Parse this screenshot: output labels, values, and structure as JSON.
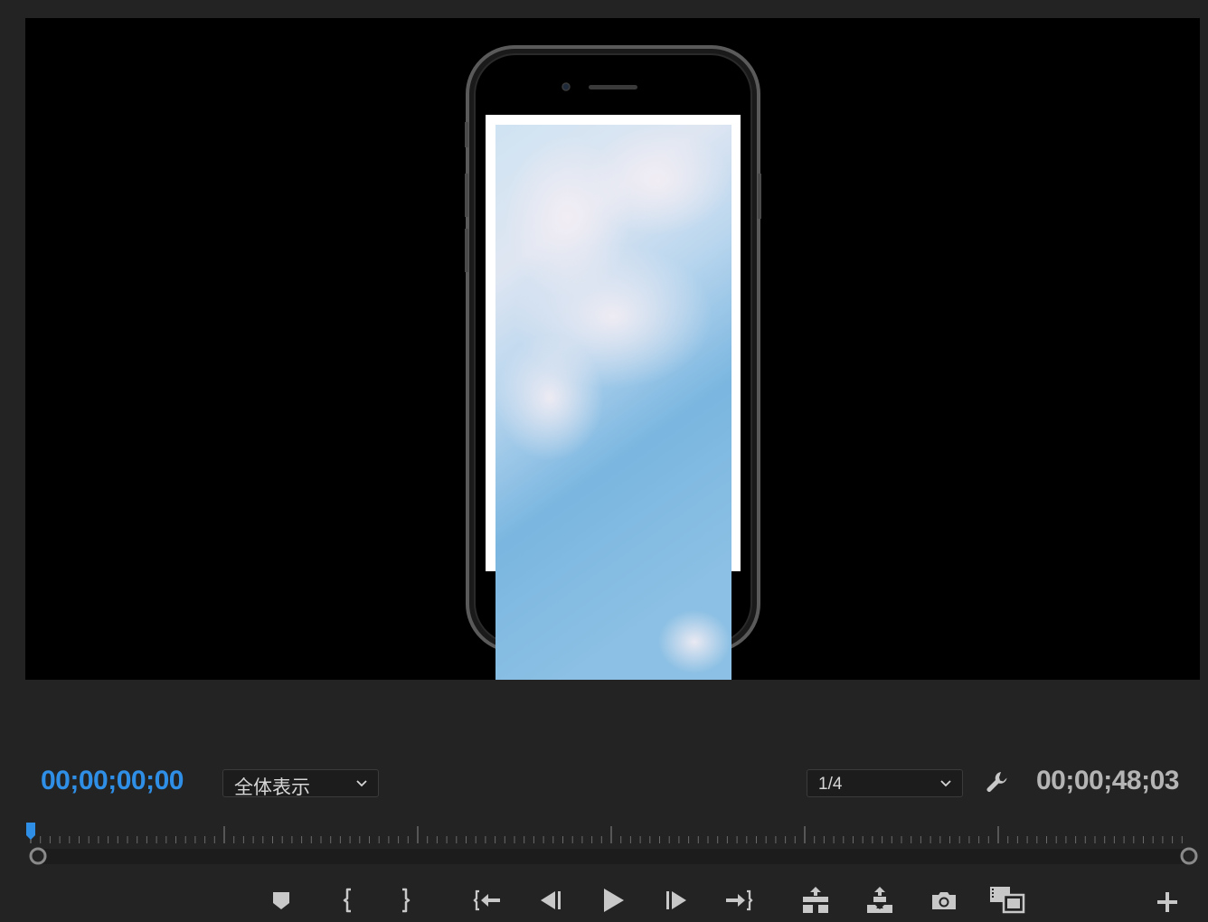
{
  "program_monitor": {
    "current_timecode": "00;00;00;00",
    "duration_timecode": "00;00;48;03",
    "zoom_level": "全体表示",
    "playback_resolution": "1/4",
    "playhead_position": 0
  },
  "transport_buttons": [
    {
      "name": "add-marker",
      "icon": "marker-icon"
    },
    {
      "name": "mark-in",
      "icon": "mark-in-icon"
    },
    {
      "name": "mark-out",
      "icon": "mark-out-icon"
    },
    {
      "name": "go-to-in",
      "icon": "go-to-in-icon"
    },
    {
      "name": "step-back",
      "icon": "step-back-icon"
    },
    {
      "name": "play",
      "icon": "play-icon"
    },
    {
      "name": "step-forward",
      "icon": "step-forward-icon"
    },
    {
      "name": "go-to-out",
      "icon": "go-to-out-icon"
    },
    {
      "name": "lift",
      "icon": "lift-icon"
    },
    {
      "name": "extract",
      "icon": "extract-icon"
    },
    {
      "name": "export-frame",
      "icon": "camera-icon"
    },
    {
      "name": "compare-view",
      "icon": "compare-view-icon"
    },
    {
      "name": "button-editor",
      "icon": "plus-icon"
    }
  ],
  "colors": {
    "accent": "#2f8ee6",
    "panel_bg": "#232323",
    "icon": "#c8c8c8"
  }
}
